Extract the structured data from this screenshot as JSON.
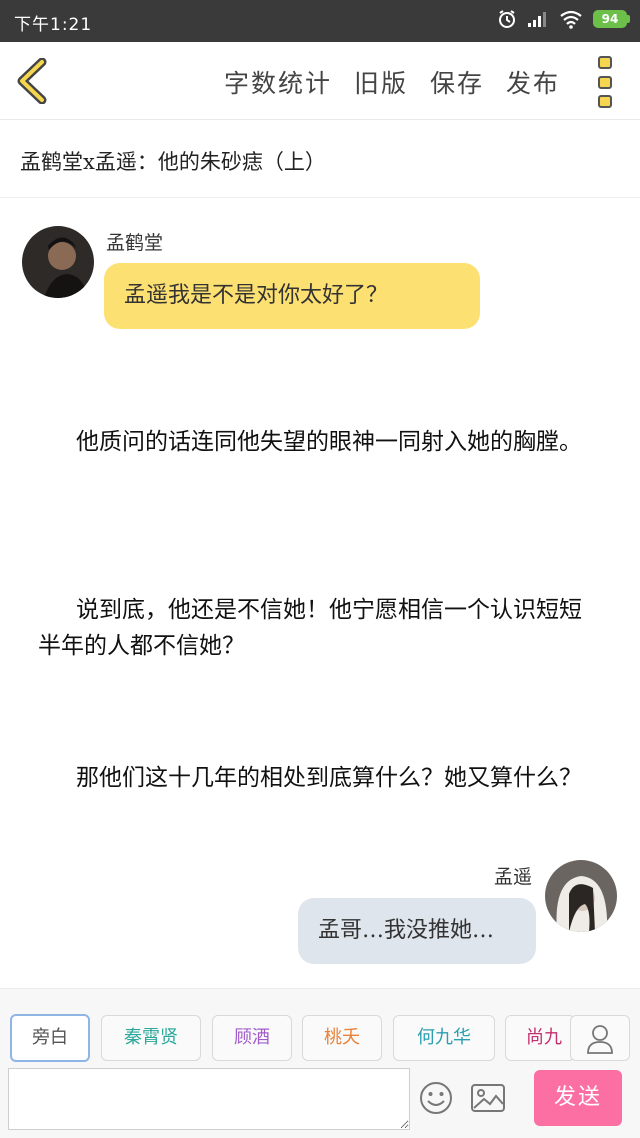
{
  "status_bar": {
    "time": "下午1:21",
    "battery": "94",
    "icons": [
      "alarm-icon",
      "signal-icon",
      "wifi-icon",
      "battery-icon"
    ]
  },
  "toolbar": {
    "back_icon": "chevron-left-icon",
    "actions": [
      "字数统计",
      "旧版",
      "保存",
      "发布"
    ],
    "more_icon": "more-vertical-icon"
  },
  "title": "孟鹤堂x孟遥：他的朱砂痣（上）",
  "messages": [
    {
      "sender": "孟鹤堂",
      "text": "孟遥我是不是对你太好了？",
      "side": "left",
      "bubble_color": "#fde072"
    },
    {
      "sender": "孟遥",
      "text": "孟哥…我没推她…",
      "side": "right",
      "bubble_color": "#dfe5ec"
    }
  ],
  "narrations": [
    "他质问的话连同他失望的眼神一同射入她的胸膛。",
    "说到底，他还是不信她！他宁愿相信一个认识短短半年的人都不信她？",
    "那他们这十几年的相处到底算什么？她又算什么？"
  ],
  "characters": [
    {
      "label": "旁白",
      "color": "#555555",
      "active": true
    },
    {
      "label": "秦霄贤",
      "color": "#2aa89a"
    },
    {
      "label": "顾酒",
      "color": "#a15cc9"
    },
    {
      "label": "桃夭",
      "color": "#e8823a"
    },
    {
      "label": "何九华",
      "color": "#2a9fb0"
    },
    {
      "label": "尚九",
      "color": "#c42f6f"
    }
  ],
  "input": {
    "placeholder": "",
    "send_label": "发送"
  },
  "colors": {
    "accent_yellow": "#f6d64e",
    "send_pink": "#fc6fa3"
  }
}
